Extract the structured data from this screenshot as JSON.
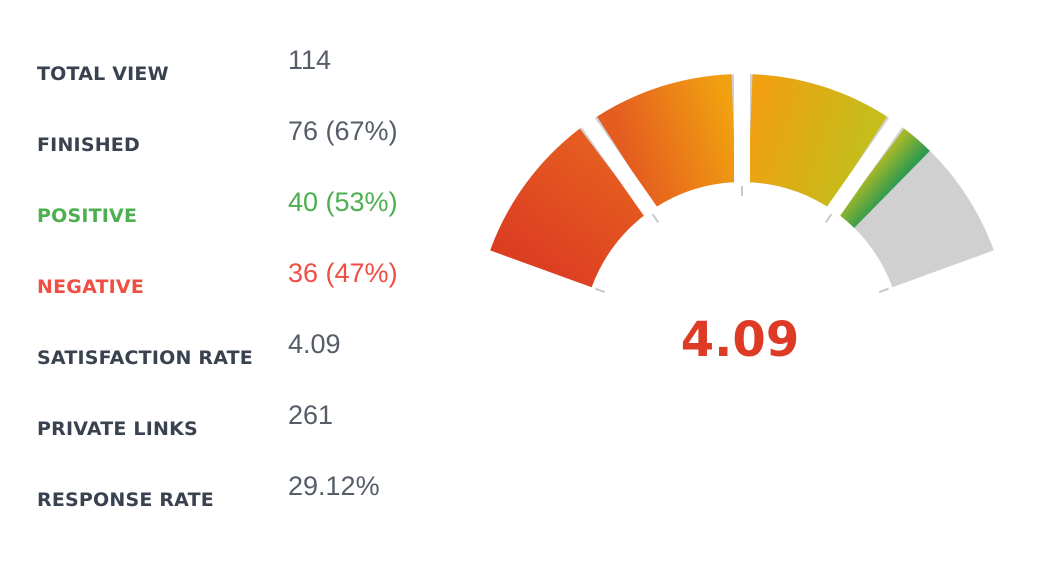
{
  "stats": [
    {
      "label": "TOTAL VIEW",
      "value": "114",
      "color": "#3a4250",
      "value_color": "#555d68"
    },
    {
      "label": "FINISHED",
      "value": "76 (67%)",
      "color": "#3a4250",
      "value_color": "#555d68"
    },
    {
      "label": "POSITIVE",
      "value": "40 (53%)",
      "color": "#4caf50",
      "value_color": "#4caf50"
    },
    {
      "label": "NEGATIVE",
      "value": "36 (47%)",
      "color": "#ef4f43",
      "value_color": "#ef4f43"
    },
    {
      "label": "SATISFACTION RATE",
      "value": "4.09",
      "color": "#3a4250",
      "value_color": "#555d68"
    },
    {
      "label": "PRIVATE LINKS",
      "value": "261",
      "color": "#3a4250",
      "value_color": "#555d68"
    },
    {
      "label": "RESPONSE RATE",
      "value": "29.12%",
      "color": "#3a4250",
      "value_color": "#555d68"
    }
  ],
  "gauge": {
    "value_text": "4.09",
    "value_color": "#dd3b26",
    "min": 0,
    "max": 5,
    "value": 4.09,
    "track_color": "#d0d0d0",
    "segment_colors": [
      [
        "#dc3e22",
        "#e55b20"
      ],
      [
        "#e55b20",
        "#f0a010"
      ],
      [
        "#f0a010",
        "#c5bd1a"
      ],
      [
        "#a5b72a",
        "#2e9b4e"
      ]
    ]
  }
}
